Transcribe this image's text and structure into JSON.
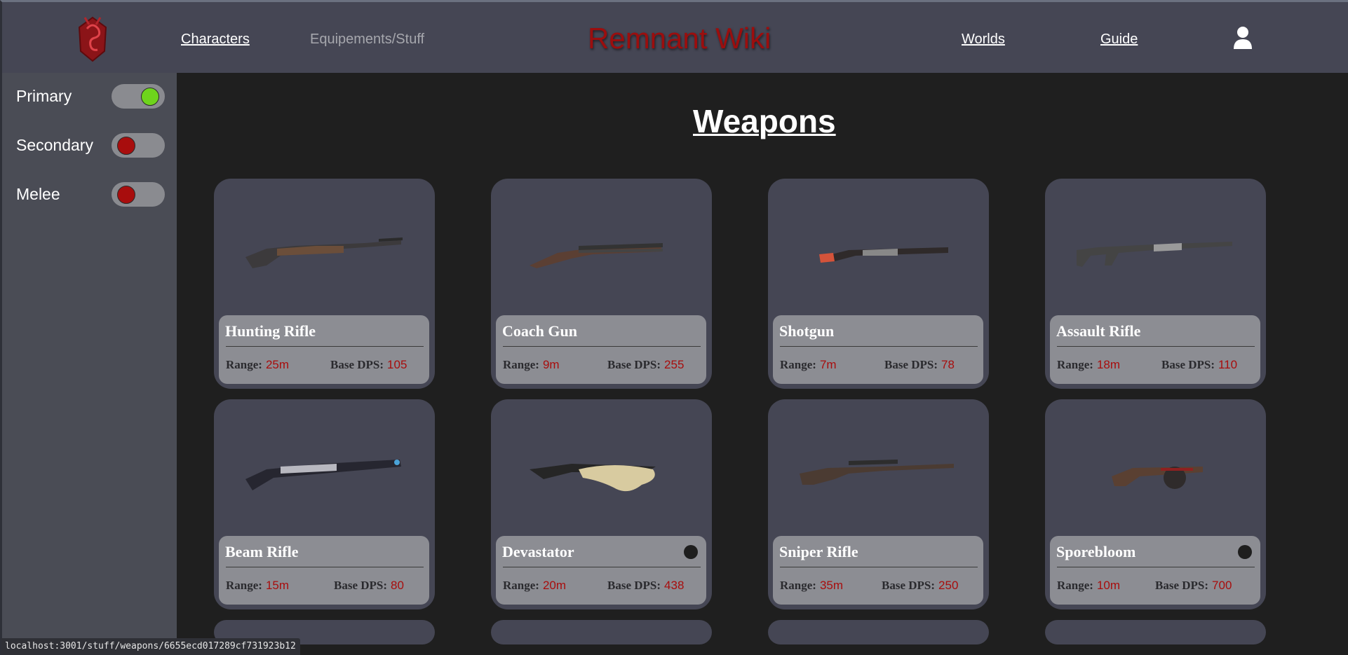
{
  "header": {
    "nav_left": [
      "Characters",
      "Equipements/Stuff"
    ],
    "site_title": "Remnant Wiki",
    "nav_right": [
      "Worlds",
      "Guide"
    ],
    "user_icon": "user-icon",
    "logo_icon": "remnant-logo-icon"
  },
  "sidebar": {
    "filters": [
      {
        "label": "Primary",
        "enabled": true
      },
      {
        "label": "Secondary",
        "enabled": false
      },
      {
        "label": "Melee",
        "enabled": false
      }
    ]
  },
  "main": {
    "title": "Weapons",
    "range_label": "Range:",
    "dps_label": "Base DPS:",
    "weapons": [
      {
        "name": "Hunting Rifle",
        "range": "25m",
        "dps": "105",
        "icon": "rifle-icon"
      },
      {
        "name": "Coach Gun",
        "range": "9m",
        "dps": "255",
        "icon": "shotgun-icon"
      },
      {
        "name": "Shotgun",
        "range": "7m",
        "dps": "78",
        "icon": "shotgun-icon"
      },
      {
        "name": "Assault Rifle",
        "range": "18m",
        "dps": "110",
        "icon": "rifle-icon"
      },
      {
        "name": "Beam Rifle",
        "range": "15m",
        "dps": "80",
        "icon": "beam-rifle-icon",
        "element": ""
      },
      {
        "name": "Devastator",
        "range": "20m",
        "dps": "438",
        "icon": "devastator-icon",
        "element": "dragon-element-icon"
      },
      {
        "name": "Sniper Rifle",
        "range": "35m",
        "dps": "250",
        "icon": "sniper-rifle-icon"
      },
      {
        "name": "Sporebloom",
        "range": "10m",
        "dps": "700",
        "icon": "sporebloom-icon",
        "element": "spore-element-icon"
      }
    ]
  },
  "status_bar": {
    "url": "localhost:3001/stuff/weapons/6655ecd017289cf731923b12"
  },
  "colors": {
    "accent_red": "#a80d0d",
    "header_bg": "#454654",
    "toggle_on": "#6ed41c"
  }
}
